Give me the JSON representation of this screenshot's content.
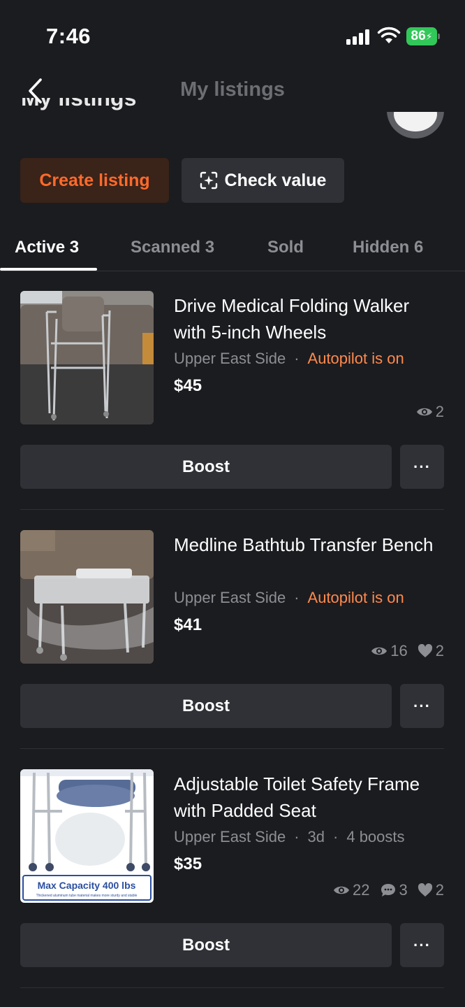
{
  "status_bar": {
    "time": "7:46",
    "battery": "86"
  },
  "nav": {
    "title": "My listings",
    "back_icon": "chevron-left-icon"
  },
  "header": {
    "ghost_title": "My listings"
  },
  "actions": {
    "create_label": "Create listing",
    "check_label": "Check value",
    "check_icon": "sparkle-scan-icon"
  },
  "tabs": [
    {
      "label": "Active 3"
    },
    {
      "label": "Scanned 3"
    },
    {
      "label": "Sold"
    },
    {
      "label": "Hidden 6"
    }
  ],
  "listings": [
    {
      "title": "Drive Medical Folding Walker with 5-inch Wheels",
      "location": "Upper East Side",
      "status": "Autopilot is on",
      "price": "$45",
      "views": "2",
      "boost_label": "Boost",
      "more_label": "···"
    },
    {
      "title": "Medline Bathtub Transfer Bench",
      "location": "Upper East Side",
      "status": "Autopilot is on",
      "price": "$41",
      "views": "16",
      "likes": "2",
      "boost_label": "Boost",
      "more_label": "···"
    },
    {
      "title": "Adjustable Toilet Safety Frame with Padded Seat",
      "location": "Upper East Side",
      "age": "3d",
      "boosts": "4 boosts",
      "price": "$35",
      "views": "22",
      "messages": "3",
      "likes": "2",
      "boost_label": "Boost",
      "more_label": "···",
      "thumb_caption": "Max Capacity 400 lbs",
      "thumb_subcaption": "Thickened aluminum tube material makes more sturdy and stable"
    }
  ],
  "colors": {
    "accent": "#ff6a2b",
    "autopilot": "#ff8a4c",
    "background": "#1b1c20",
    "surface": "#2f3136"
  }
}
